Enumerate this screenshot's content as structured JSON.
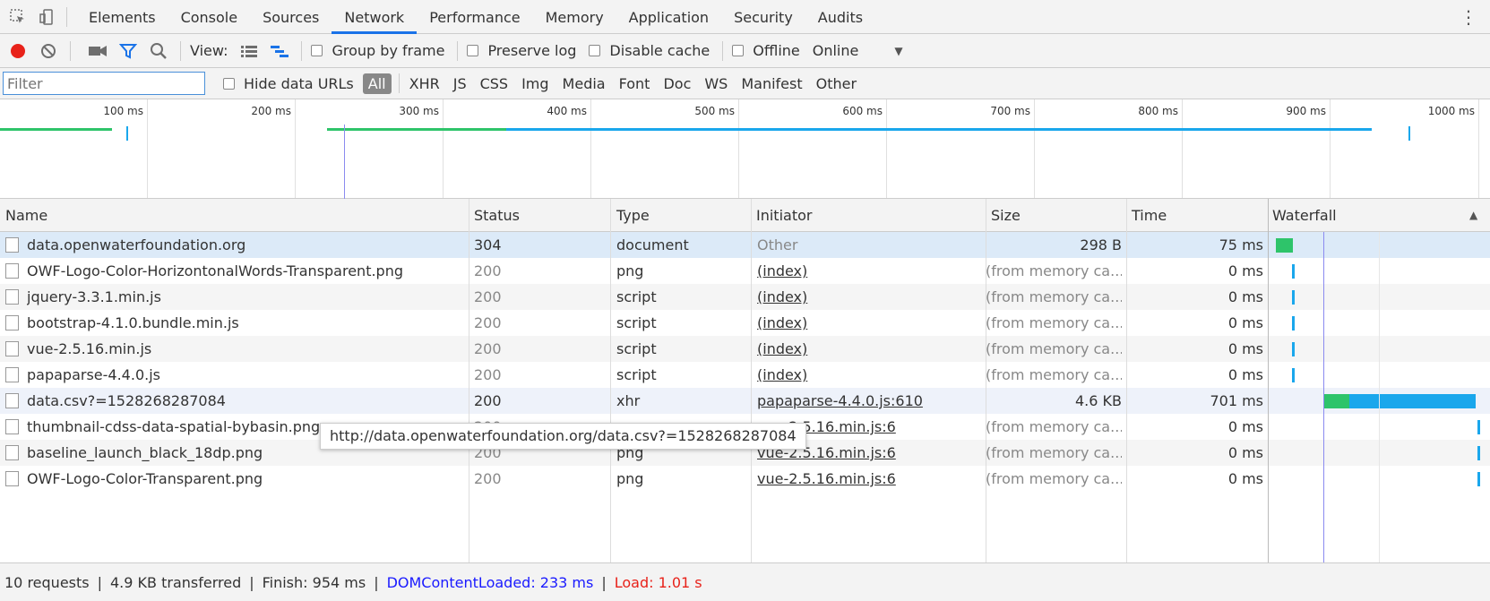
{
  "tabbar": {
    "tabs": [
      "Elements",
      "Console",
      "Sources",
      "Network",
      "Performance",
      "Memory",
      "Application",
      "Security",
      "Audits"
    ],
    "active": "Network"
  },
  "toolbar": {
    "view_label": "View:",
    "group_by_frame": "Group by frame",
    "preserve_log": "Preserve log",
    "disable_cache": "Disable cache",
    "offline": "Offline",
    "throttle_value": "Online",
    "record_color": "#e8221a"
  },
  "filterbar": {
    "placeholder": "Filter",
    "hide_data_urls": "Hide data URLs",
    "types": [
      "All",
      "XHR",
      "JS",
      "CSS",
      "Img",
      "Media",
      "Font",
      "Doc",
      "WS",
      "Manifest",
      "Other"
    ],
    "active_type": "All"
  },
  "overview": {
    "ticks": [
      "100 ms",
      "200 ms",
      "300 ms",
      "400 ms",
      "500 ms",
      "600 ms",
      "700 ms",
      "800 ms",
      "900 ms",
      "1000 ms"
    ]
  },
  "table": {
    "headers": {
      "name": "Name",
      "status": "Status",
      "type": "Type",
      "initiator": "Initiator",
      "size": "Size",
      "time": "Time",
      "waterfall": "Waterfall"
    },
    "rows": [
      {
        "name": "data.openwaterfoundation.org",
        "status": "304",
        "type": "document",
        "initiator": "Other",
        "size": "298 B",
        "time": "75 ms"
      },
      {
        "name": "OWF-Logo-Color-HorizontonalWords-Transparent.png",
        "status": "200",
        "type": "png",
        "initiator": "(index)",
        "size": "(from memory ca...",
        "time": "0 ms"
      },
      {
        "name": "jquery-3.3.1.min.js",
        "status": "200",
        "type": "script",
        "initiator": "(index)",
        "size": "(from memory ca...",
        "time": "0 ms"
      },
      {
        "name": "bootstrap-4.1.0.bundle.min.js",
        "status": "200",
        "type": "script",
        "initiator": "(index)",
        "size": "(from memory ca...",
        "time": "0 ms"
      },
      {
        "name": "vue-2.5.16.min.js",
        "status": "200",
        "type": "script",
        "initiator": "(index)",
        "size": "(from memory ca...",
        "time": "0 ms"
      },
      {
        "name": "papaparse-4.4.0.js",
        "status": "200",
        "type": "script",
        "initiator": "(index)",
        "size": "(from memory ca...",
        "time": "0 ms"
      },
      {
        "name": "data.csv?=1528268287084",
        "status": "200",
        "type": "xhr",
        "initiator": "papaparse-4.4.0.js:610",
        "size": "4.6 KB",
        "time": "701 ms"
      },
      {
        "name": "thumbnail-cdss-data-spatial-bybasin.png",
        "status": "200",
        "type": "png",
        "initiator": "vue-2.5.16.min.js:6",
        "size": "(from memory ca...",
        "time": "0 ms"
      },
      {
        "name": "baseline_launch_black_18dp.png",
        "status": "200",
        "type": "png",
        "initiator": "vue-2.5.16.min.js:6",
        "size": "(from memory ca...",
        "time": "0 ms"
      },
      {
        "name": "OWF-Logo-Color-Transparent.png",
        "status": "200",
        "type": "png",
        "initiator": "vue-2.5.16.min.js:6",
        "size": "(from memory ca...",
        "time": "0 ms"
      }
    ]
  },
  "tooltip": "http://data.openwaterfoundation.org/data.csv?=1528268287084",
  "statusbar": {
    "requests": "10 requests",
    "transferred": "4.9 KB transferred",
    "finish": "Finish: 954 ms",
    "domcontentloaded": "DOMContentLoaded: 233 ms",
    "load": "Load: 1.01 s",
    "dcl_color": "#1a1aff",
    "load_color": "#e8221a"
  }
}
